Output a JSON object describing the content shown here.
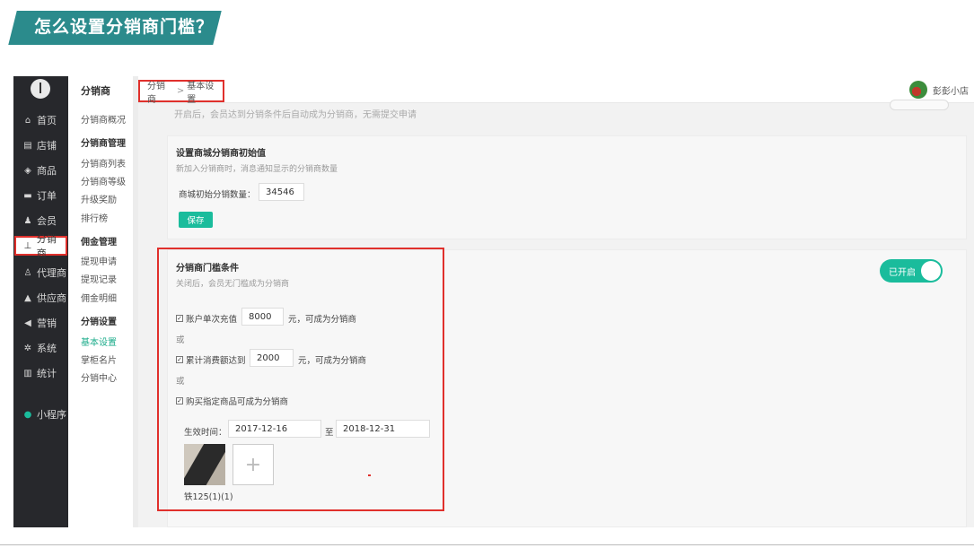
{
  "banner": {
    "title": "怎么设置分销商门槛？"
  },
  "sidebar": {
    "items": [
      {
        "icon": "home-icon",
        "label": "首页"
      },
      {
        "icon": "store-icon",
        "label": "店铺"
      },
      {
        "icon": "product-icon",
        "label": "商品"
      },
      {
        "icon": "order-icon",
        "label": "订单"
      },
      {
        "icon": "member-icon",
        "label": "会员"
      },
      {
        "icon": "distributor-icon",
        "label": "分销商"
      },
      {
        "icon": "agent-icon",
        "label": "代理商"
      },
      {
        "icon": "supplier-icon",
        "label": "供应商"
      },
      {
        "icon": "marketing-icon",
        "label": "营销"
      },
      {
        "icon": "settings-icon",
        "label": "系统"
      },
      {
        "icon": "stats-icon",
        "label": "统计"
      },
      {
        "icon": "miniprogram-icon",
        "label": "小程序"
      }
    ]
  },
  "subnav": {
    "title": "分销商",
    "overview": "分销商概况",
    "group1": "分销商管理",
    "list": "分销商列表",
    "levels": "分销商等级",
    "upgrade": "升级奖励",
    "ranking": "排行榜",
    "group2": "佣金管理",
    "withdraw_apply": "提现申请",
    "withdraw_record": "提现记录",
    "commission_detail": "佣金明细",
    "group3": "分销设置",
    "basic": "基本设置",
    "card": "掌柜名片",
    "center": "分销中心"
  },
  "breadcrumb": {
    "parent": "分销商",
    "sep": ">",
    "current": "基本设置"
  },
  "user": {
    "name": "彭彭小店"
  },
  "faded_desc": "开启后，会员达到分销条件后自动成为分销商，无需提交申请",
  "initial": {
    "title": "设置商城分销商初始值",
    "desc": "新加入分销商时，消息通知显示的分销商数量",
    "label": "商城初始分销数量：",
    "value": "34546",
    "save": "保存"
  },
  "threshold": {
    "title": "分销商门槛条件",
    "desc": "关闭后，会员无门槛成为分销商",
    "toggle": "已开启",
    "cond1_prefix": "账户单次充值",
    "cond1_value": "8000",
    "cond1_suffix": "元，可成为分销商",
    "or": "或",
    "cond2_prefix": "累计消费额达到",
    "cond2_value": "2000",
    "cond2_suffix": "元，可成为分销商",
    "cond3": "购买指定商品可成为分销商",
    "date_label": "生效时间：",
    "date_start": "2017-12-16",
    "date_to": "至",
    "date_end": "2018-12-31",
    "product_name": "铁125(1)(1)",
    "add_symbol": "+"
  }
}
